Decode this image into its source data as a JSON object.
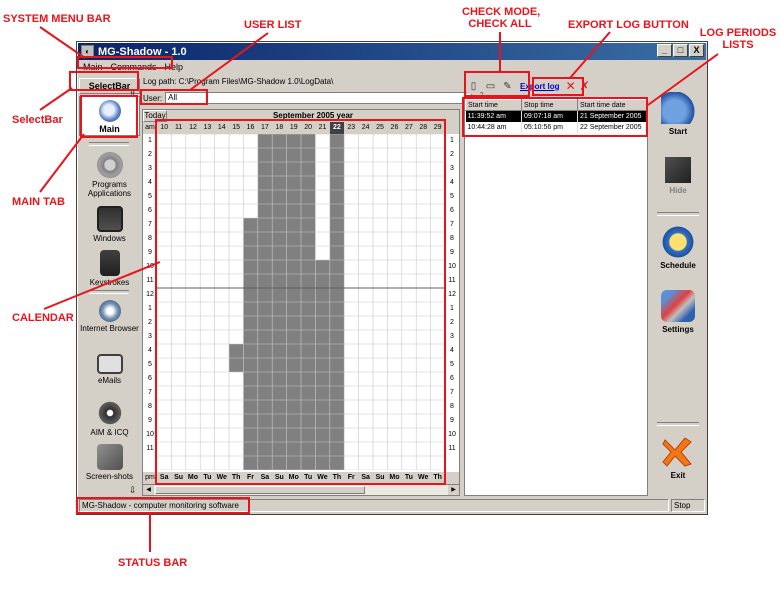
{
  "annotations": {
    "system_menu_bar": "SYSTEM MENU BAR",
    "user_list": "USER LIST",
    "check_mode": "CHECK MODE,",
    "check_all": "CHECK ALL",
    "export_log_button": "EXPORT LOG BUTTON",
    "log_periods": "LOG PERIODS",
    "lists": "LISTS",
    "selectbar": "SelectBar",
    "main_tab": "MAIN TAB",
    "calendar": "CALENDAR",
    "status_bar": "STATUS BAR",
    "color": "#e8141c"
  },
  "window": {
    "title": "MG-Shadow - 1.0",
    "buttons": [
      "_",
      "□",
      "X"
    ]
  },
  "menu": [
    "Main",
    "Commands",
    "Help"
  ],
  "selectbar_label": "SelectBar",
  "tabs": [
    {
      "label": "Main",
      "icon": "main-clock-icon",
      "active": true
    },
    {
      "label": "Programs Applications",
      "icon": "programs-gear-icon"
    },
    {
      "label": "Windows",
      "icon": "windows-icon"
    },
    {
      "label": "Keystrokes",
      "icon": "keyboard-icon"
    },
    {
      "label": "Internet Browser",
      "icon": "internet-explorer-icon"
    },
    {
      "label": "eMails",
      "icon": "email-icon"
    },
    {
      "label": "AIM & ICQ",
      "icon": "chat-flower-icon"
    },
    {
      "label": "Screen-shots",
      "icon": "screenshot-icon"
    }
  ],
  "log_path": "Log path: C:\\Program Files\\MG-Shadow 1.0\\LogData\\",
  "user_label": "User:",
  "user_value": "All",
  "calendar": {
    "today_label": "Today",
    "title": "September 2005 year",
    "am_label": "am",
    "pm_label": "pm",
    "days": [
      "10",
      "11",
      "12",
      "13",
      "14",
      "15",
      "16",
      "17",
      "18",
      "19",
      "20",
      "21",
      "22",
      "23",
      "24",
      "25",
      "26",
      "27",
      "28",
      "29"
    ],
    "today_day": "22",
    "weekdays": [
      "Sa",
      "Su",
      "Mo",
      "Tu",
      "We",
      "Th",
      "Fr",
      "Sa",
      "Su",
      "Mo",
      "Tu",
      "We",
      "Th",
      "Fr",
      "Sa",
      "Su",
      "Mo",
      "Tu",
      "We",
      "Th"
    ],
    "hours": [
      "1",
      "2",
      "3",
      "4",
      "5",
      "6",
      "7",
      "8",
      "9",
      "10",
      "11",
      "12",
      "1",
      "2",
      "3",
      "4",
      "5",
      "6",
      "7",
      "8",
      "9",
      "10",
      "11"
    ],
    "activity_color": "#808080",
    "activity": [
      [],
      [],
      [],
      [],
      [],
      [
        15,
        16
      ],
      [
        6,
        7,
        8,
        9,
        10,
        11,
        12,
        13,
        14,
        15,
        16,
        17,
        18,
        19,
        20,
        21,
        22,
        23
      ],
      [
        0,
        1,
        2,
        3,
        4,
        5,
        6,
        7,
        8,
        9,
        10,
        11,
        12,
        13,
        14,
        15,
        16,
        17,
        18,
        19,
        20,
        21,
        22,
        23
      ],
      [
        0,
        1,
        2,
        3,
        4,
        5,
        6,
        7,
        8,
        9,
        10,
        11,
        12,
        13,
        14,
        15,
        16,
        17,
        18,
        19,
        20,
        21,
        22,
        23
      ],
      [
        0,
        1,
        2,
        3,
        4,
        5,
        6,
        7,
        8,
        9,
        10,
        11,
        12,
        13,
        14,
        15,
        16,
        17,
        18,
        19,
        20,
        21,
        22,
        23
      ],
      [
        0,
        1,
        2,
        3,
        4,
        5,
        6,
        7,
        8,
        9,
        10,
        11,
        12,
        13,
        14,
        15,
        16,
        17,
        18,
        19,
        20,
        21,
        22,
        23
      ],
      [
        9,
        10,
        11,
        12,
        13,
        14,
        15,
        16,
        17,
        18,
        19,
        20,
        21,
        22,
        23
      ],
      [
        0,
        1,
        2,
        3,
        4,
        5,
        6,
        7,
        8,
        9,
        10,
        11,
        12,
        13,
        14,
        15,
        16,
        17,
        18,
        19,
        20,
        21,
        22,
        23
      ],
      [],
      [],
      [],
      [],
      [],
      [],
      []
    ]
  },
  "log_toolbar": {
    "export_label": "Export log"
  },
  "log_table": {
    "columns": [
      "Start time",
      "Stop time",
      "Start time date"
    ],
    "rows": [
      [
        "11:39:52 am",
        "09:07:18 am",
        "21 September 2005"
      ],
      [
        "10:44:28 am",
        "05:10:56 pm",
        "22 September 2005"
      ]
    ]
  },
  "right_buttons": [
    {
      "label": "Start",
      "icon": "start-pen-icon",
      "disabled": false
    },
    {
      "label": "Hide",
      "icon": "hide-book-icon",
      "disabled": true
    },
    {
      "label": "Schedule",
      "icon": "schedule-clock-icon",
      "disabled": false
    },
    {
      "label": "Settings",
      "icon": "settings-tools-icon",
      "disabled": false
    },
    {
      "label": "Exit",
      "icon": "exit-x-icon",
      "disabled": false
    }
  ],
  "status": {
    "text": "MG-Shadow - computer monitoring software",
    "right": "Stop"
  }
}
